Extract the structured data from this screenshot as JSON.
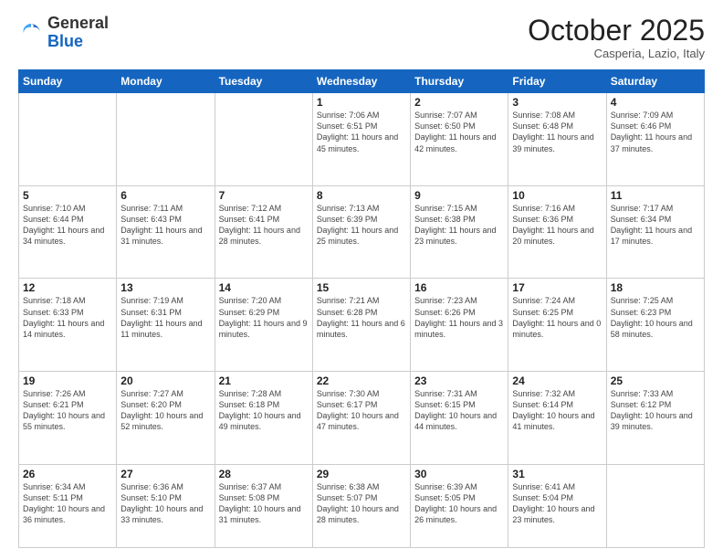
{
  "header": {
    "logo_general": "General",
    "logo_blue": "Blue",
    "month_title": "October 2025",
    "subtitle": "Casperia, Lazio, Italy"
  },
  "weekdays": [
    "Sunday",
    "Monday",
    "Tuesday",
    "Wednesday",
    "Thursday",
    "Friday",
    "Saturday"
  ],
  "weeks": [
    [
      {
        "day": "",
        "info": ""
      },
      {
        "day": "",
        "info": ""
      },
      {
        "day": "",
        "info": ""
      },
      {
        "day": "1",
        "info": "Sunrise: 7:06 AM\nSunset: 6:51 PM\nDaylight: 11 hours\nand 45 minutes."
      },
      {
        "day": "2",
        "info": "Sunrise: 7:07 AM\nSunset: 6:50 PM\nDaylight: 11 hours\nand 42 minutes."
      },
      {
        "day": "3",
        "info": "Sunrise: 7:08 AM\nSunset: 6:48 PM\nDaylight: 11 hours\nand 39 minutes."
      },
      {
        "day": "4",
        "info": "Sunrise: 7:09 AM\nSunset: 6:46 PM\nDaylight: 11 hours\nand 37 minutes."
      }
    ],
    [
      {
        "day": "5",
        "info": "Sunrise: 7:10 AM\nSunset: 6:44 PM\nDaylight: 11 hours\nand 34 minutes."
      },
      {
        "day": "6",
        "info": "Sunrise: 7:11 AM\nSunset: 6:43 PM\nDaylight: 11 hours\nand 31 minutes."
      },
      {
        "day": "7",
        "info": "Sunrise: 7:12 AM\nSunset: 6:41 PM\nDaylight: 11 hours\nand 28 minutes."
      },
      {
        "day": "8",
        "info": "Sunrise: 7:13 AM\nSunset: 6:39 PM\nDaylight: 11 hours\nand 25 minutes."
      },
      {
        "day": "9",
        "info": "Sunrise: 7:15 AM\nSunset: 6:38 PM\nDaylight: 11 hours\nand 23 minutes."
      },
      {
        "day": "10",
        "info": "Sunrise: 7:16 AM\nSunset: 6:36 PM\nDaylight: 11 hours\nand 20 minutes."
      },
      {
        "day": "11",
        "info": "Sunrise: 7:17 AM\nSunset: 6:34 PM\nDaylight: 11 hours\nand 17 minutes."
      }
    ],
    [
      {
        "day": "12",
        "info": "Sunrise: 7:18 AM\nSunset: 6:33 PM\nDaylight: 11 hours\nand 14 minutes."
      },
      {
        "day": "13",
        "info": "Sunrise: 7:19 AM\nSunset: 6:31 PM\nDaylight: 11 hours\nand 11 minutes."
      },
      {
        "day": "14",
        "info": "Sunrise: 7:20 AM\nSunset: 6:29 PM\nDaylight: 11 hours\nand 9 minutes."
      },
      {
        "day": "15",
        "info": "Sunrise: 7:21 AM\nSunset: 6:28 PM\nDaylight: 11 hours\nand 6 minutes."
      },
      {
        "day": "16",
        "info": "Sunrise: 7:23 AM\nSunset: 6:26 PM\nDaylight: 11 hours\nand 3 minutes."
      },
      {
        "day": "17",
        "info": "Sunrise: 7:24 AM\nSunset: 6:25 PM\nDaylight: 11 hours\nand 0 minutes."
      },
      {
        "day": "18",
        "info": "Sunrise: 7:25 AM\nSunset: 6:23 PM\nDaylight: 10 hours\nand 58 minutes."
      }
    ],
    [
      {
        "day": "19",
        "info": "Sunrise: 7:26 AM\nSunset: 6:21 PM\nDaylight: 10 hours\nand 55 minutes."
      },
      {
        "day": "20",
        "info": "Sunrise: 7:27 AM\nSunset: 6:20 PM\nDaylight: 10 hours\nand 52 minutes."
      },
      {
        "day": "21",
        "info": "Sunrise: 7:28 AM\nSunset: 6:18 PM\nDaylight: 10 hours\nand 49 minutes."
      },
      {
        "day": "22",
        "info": "Sunrise: 7:30 AM\nSunset: 6:17 PM\nDaylight: 10 hours\nand 47 minutes."
      },
      {
        "day": "23",
        "info": "Sunrise: 7:31 AM\nSunset: 6:15 PM\nDaylight: 10 hours\nand 44 minutes."
      },
      {
        "day": "24",
        "info": "Sunrise: 7:32 AM\nSunset: 6:14 PM\nDaylight: 10 hours\nand 41 minutes."
      },
      {
        "day": "25",
        "info": "Sunrise: 7:33 AM\nSunset: 6:12 PM\nDaylight: 10 hours\nand 39 minutes."
      }
    ],
    [
      {
        "day": "26",
        "info": "Sunrise: 6:34 AM\nSunset: 5:11 PM\nDaylight: 10 hours\nand 36 minutes."
      },
      {
        "day": "27",
        "info": "Sunrise: 6:36 AM\nSunset: 5:10 PM\nDaylight: 10 hours\nand 33 minutes."
      },
      {
        "day": "28",
        "info": "Sunrise: 6:37 AM\nSunset: 5:08 PM\nDaylight: 10 hours\nand 31 minutes."
      },
      {
        "day": "29",
        "info": "Sunrise: 6:38 AM\nSunset: 5:07 PM\nDaylight: 10 hours\nand 28 minutes."
      },
      {
        "day": "30",
        "info": "Sunrise: 6:39 AM\nSunset: 5:05 PM\nDaylight: 10 hours\nand 26 minutes."
      },
      {
        "day": "31",
        "info": "Sunrise: 6:41 AM\nSunset: 5:04 PM\nDaylight: 10 hours\nand 23 minutes."
      },
      {
        "day": "",
        "info": ""
      }
    ]
  ]
}
